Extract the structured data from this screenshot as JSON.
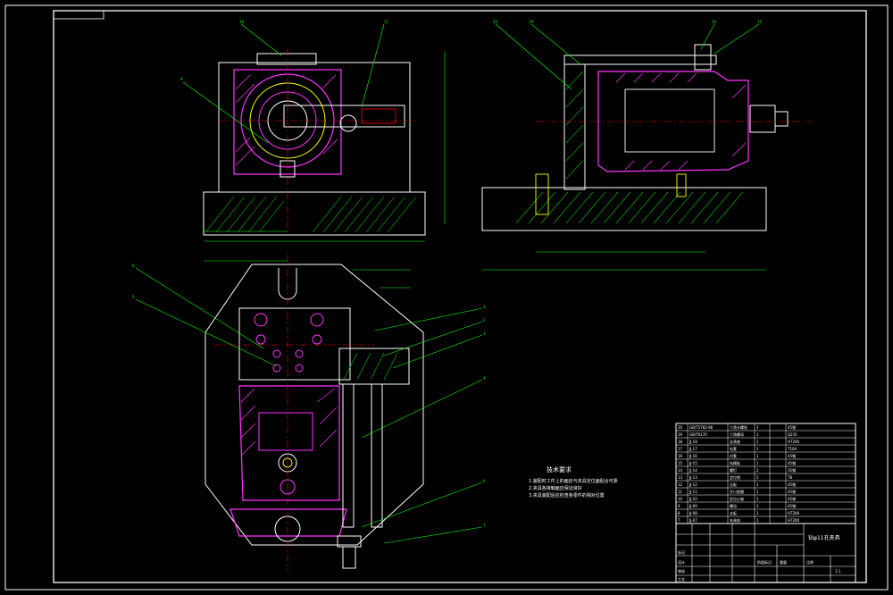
{
  "drawing": {
    "title_block_name": "钻φ11孔夹具",
    "drawing_no": "",
    "tech_requirements_title": "技术要求",
    "tech_requirements": [
      "1.装配时工件上的面应与夹具定位面贴合可靠",
      "2.夹具各接触面应保证良好",
      "3.夹具装配后应检查各零件的相对位置"
    ]
  },
  "callouts": {
    "top_view": [
      "18",
      "11",
      "9"
    ],
    "side_view": [
      "20",
      "19",
      "16",
      "15"
    ],
    "front_view_left": [
      "8",
      "5"
    ],
    "front_view_right": [
      "1",
      "2",
      "3",
      "4",
      "6",
      "7"
    ]
  },
  "bom": {
    "rows": [
      {
        "no": "20",
        "code": "GB/T5782-86",
        "name": "六角头螺栓",
        "qty": "1",
        "material": "45钢"
      },
      {
        "no": "19",
        "code": "GB/T6170",
        "name": "六角螺母",
        "qty": "1",
        "material": "Q235"
      },
      {
        "no": "18",
        "code": "JJ-18",
        "name": "支承座",
        "qty": "1",
        "material": "HT200"
      },
      {
        "no": "17",
        "code": "JJ-17",
        "name": "钻套",
        "qty": "1",
        "material": "T10A"
      },
      {
        "no": "16",
        "code": "JJ-16",
        "name": "衬套",
        "qty": "1",
        "material": "45钢"
      },
      {
        "no": "15",
        "code": "JJ-15",
        "name": "钻模板",
        "qty": "1",
        "material": "45钢"
      },
      {
        "no": "14",
        "code": "JJ-14",
        "name": "螺钉",
        "qty": "2",
        "material": "35钢"
      },
      {
        "no": "13",
        "code": "JJ-13",
        "name": "定位销",
        "qty": "2",
        "material": "T8"
      },
      {
        "no": "12",
        "code": "JJ-12",
        "name": "压板",
        "qty": "1",
        "material": "45钢"
      },
      {
        "no": "11",
        "code": "JJ-11",
        "name": "开口垫圈",
        "qty": "1",
        "material": "45钢"
      },
      {
        "no": "10",
        "code": "JJ-10",
        "name": "定位心轴",
        "qty": "1",
        "material": "45钢"
      },
      {
        "no": "9",
        "code": "JJ-09",
        "name": "螺母",
        "qty": "1",
        "material": "45钢"
      },
      {
        "no": "8",
        "code": "JJ-08",
        "name": "支板",
        "qty": "1",
        "material": "HT200"
      },
      {
        "no": "7",
        "code": "JJ-07",
        "name": "夹具体",
        "qty": "1",
        "material": "HT200"
      }
    ]
  },
  "title_block": {
    "left_labels": [
      "标记",
      "设计",
      "审核",
      "工艺"
    ],
    "right_labels": [
      "阶段标记",
      "重量",
      "比例"
    ],
    "scale": "1:1"
  }
}
